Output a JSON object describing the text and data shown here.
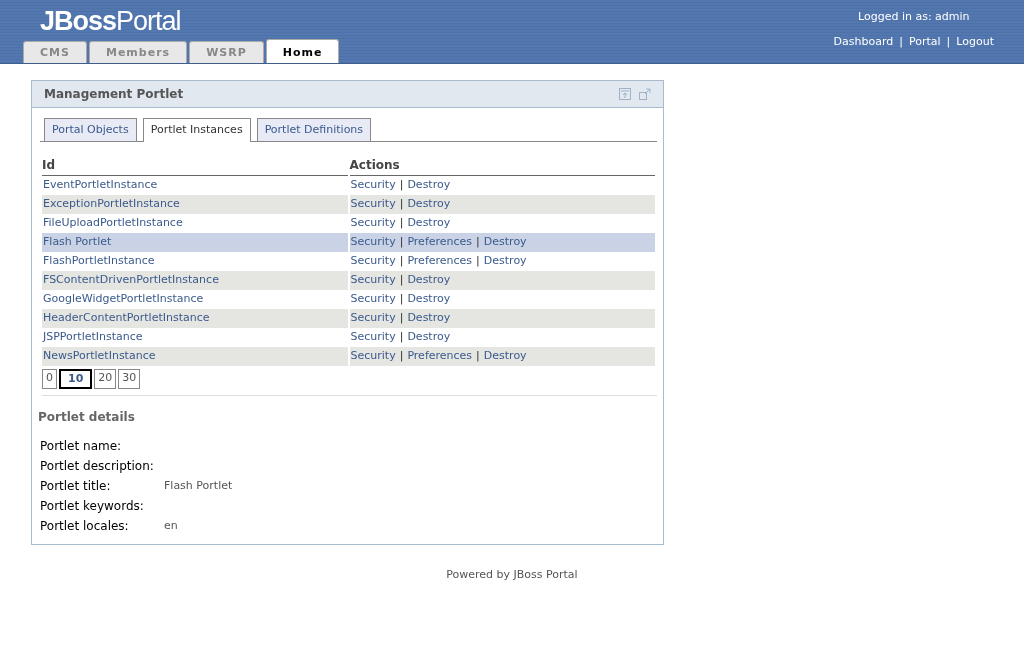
{
  "header": {
    "logo_bold": "JBoss",
    "logo_light": "Portal",
    "logged_in": "Logged in as: admin",
    "links": [
      "Dashboard",
      "Portal",
      "Logout"
    ],
    "link_separator": "|",
    "tabs": [
      {
        "label": "CMS",
        "selected": false
      },
      {
        "label": "Members",
        "selected": false
      },
      {
        "label": "WSRP",
        "selected": false
      },
      {
        "label": "Home",
        "selected": true
      }
    ]
  },
  "portlet": {
    "title": "Management Portlet",
    "tabs": [
      {
        "label": "Portal Objects",
        "selected": false
      },
      {
        "label": "Portlet Instances",
        "selected": true
      },
      {
        "label": "Portlet Definitions",
        "selected": false
      }
    ],
    "table": {
      "columns": [
        "Id",
        "Actions"
      ],
      "action_separator": "|",
      "rows": [
        {
          "id": "EventPortletInstance",
          "actions": [
            "Security",
            "Destroy"
          ],
          "selected": false
        },
        {
          "id": "ExceptionPortletInstance",
          "actions": [
            "Security",
            "Destroy"
          ],
          "selected": false
        },
        {
          "id": "FileUploadPortletInstance",
          "actions": [
            "Security",
            "Destroy"
          ],
          "selected": false
        },
        {
          "id": "Flash Portlet",
          "actions": [
            "Security",
            "Preferences",
            "Destroy"
          ],
          "selected": true
        },
        {
          "id": "FlashPortletInstance",
          "actions": [
            "Security",
            "Preferences",
            "Destroy"
          ],
          "selected": false
        },
        {
          "id": "FSContentDrivenPortletInstance",
          "actions": [
            "Security",
            "Destroy"
          ],
          "selected": false
        },
        {
          "id": "GoogleWidgetPortletInstance",
          "actions": [
            "Security",
            "Destroy"
          ],
          "selected": false
        },
        {
          "id": "HeaderContentPortletInstance",
          "actions": [
            "Security",
            "Destroy"
          ],
          "selected": false
        },
        {
          "id": "JSPPortletInstance",
          "actions": [
            "Security",
            "Destroy"
          ],
          "selected": false
        },
        {
          "id": "NewsPortletInstance",
          "actions": [
            "Security",
            "Preferences",
            "Destroy"
          ],
          "selected": false
        }
      ]
    },
    "pages": [
      {
        "label": "0",
        "selected": false
      },
      {
        "label": "10",
        "selected": true
      },
      {
        "label": "20",
        "selected": false
      },
      {
        "label": "30",
        "selected": false
      }
    ],
    "details_title": "Portlet details",
    "details": [
      {
        "label": "Portlet name:"
      },
      {
        "label": "Portlet description:"
      },
      {
        "label": "Portlet title:",
        "value": "Flash Portlet"
      },
      {
        "label": "Portlet keywords:"
      },
      {
        "label": "Portlet locales:",
        "value": "en"
      }
    ]
  },
  "footer": "Powered by JBoss Portal"
}
